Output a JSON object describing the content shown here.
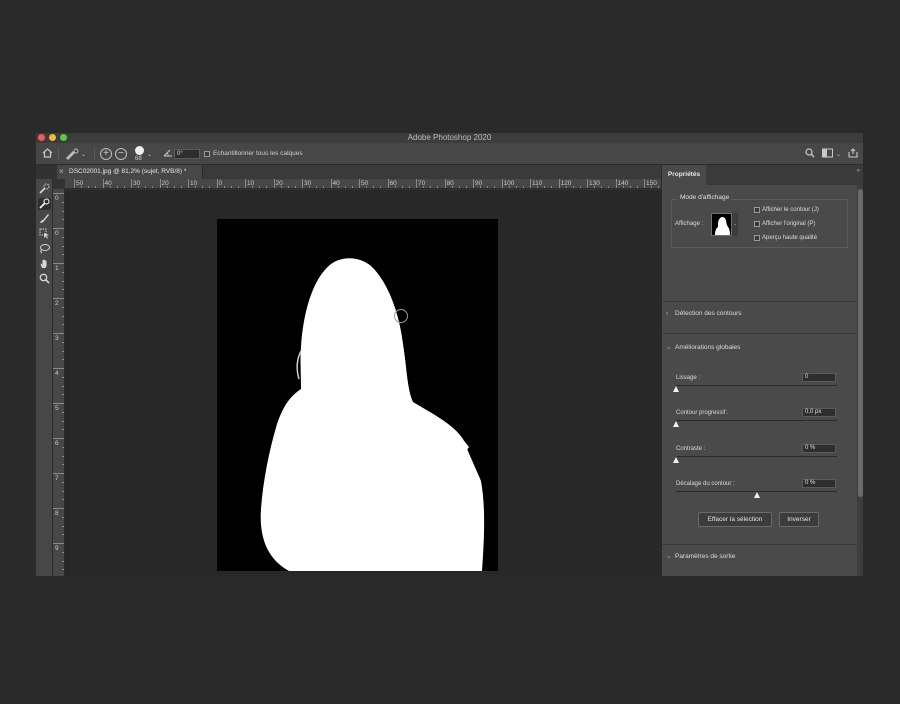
{
  "app": {
    "window_title": "Adobe Photoshop 2020"
  },
  "options_bar": {
    "brush_size": "68",
    "angle_value": "0°",
    "sample_all_layers_label": "Echantillonner tous les calques"
  },
  "document_tab": {
    "name": "DSC02001.jpg @ 81,2% (sujet, RVB/8) *",
    "close_glyph": "×"
  },
  "ruler_top": {
    "ticks": [
      "50",
      "40",
      "30",
      "20",
      "10",
      "0",
      "10",
      "20",
      "30",
      "40",
      "50",
      "60",
      "70",
      "80",
      "90",
      "100",
      "110",
      "120",
      "130",
      "140",
      "150"
    ]
  },
  "ruler_left": {
    "ticks": [
      "0",
      "0",
      "1",
      "2",
      "3",
      "4",
      "5",
      "6",
      "7",
      "8",
      "9"
    ]
  },
  "panel": {
    "tab_label": "Propriétés",
    "view_mode": {
      "legend": "Mode d'affichage",
      "view_label": "Affichage :",
      "options": [
        {
          "label": "Afficher le contour (J)",
          "checked": false
        },
        {
          "label": "Afficher l'original (P)",
          "checked": false
        },
        {
          "label": "Aperçu haute qualité",
          "checked": false
        }
      ]
    },
    "edge_detection": {
      "title": "Détection des contours",
      "expanded": false
    },
    "global_refinements": {
      "title": "Améliorations globales",
      "expanded": true,
      "sliders": [
        {
          "label": "Lissage :",
          "value": "0",
          "position": 0
        },
        {
          "label": "Contour progressif :",
          "value": "0,0 px",
          "position": 0
        },
        {
          "label": "Contraste :",
          "value": "0 %",
          "position": 0
        },
        {
          "label": "Décalage du contour :",
          "value": "0 %",
          "position": 0.5
        }
      ],
      "clear_selection_label": "Effacer la sélection",
      "invert_label": "Inverser"
    },
    "output_settings": {
      "title": "Paramètres de sortie",
      "expanded": false
    }
  },
  "colors": {
    "mask_foreground": "#ffffff",
    "mask_background": "#000000",
    "ui_dark": "#323232",
    "ui_panel": "#4a4a4a"
  }
}
